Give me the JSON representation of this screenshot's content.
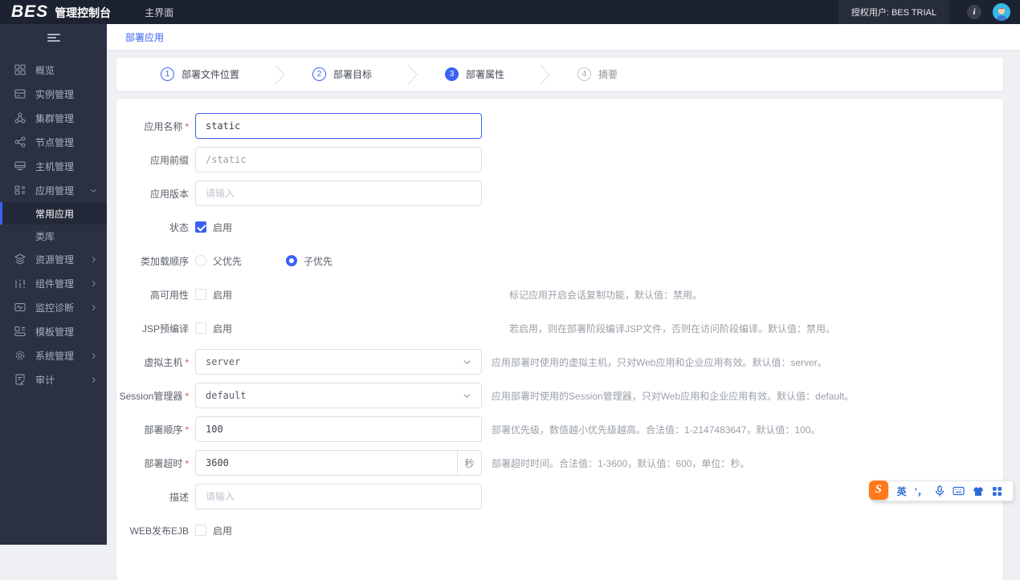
{
  "colors": {
    "accent": "#3a62f2",
    "topbar_bg": "#1d2230",
    "sidebar_bg": "#2b3143",
    "active_border": "#3a62f2",
    "sogou_orange": "#ff7a1c"
  },
  "topbar": {
    "logo_bes": "BES",
    "logo_suffix": "管理控制台",
    "tab_main": "主界面",
    "auth_user": "授权用户: BES TRIAL"
  },
  "sidebar": {
    "items": [
      {
        "label": "概览",
        "icon": "overview-icon"
      },
      {
        "label": "实例管理",
        "icon": "instance-icon"
      },
      {
        "label": "集群管理",
        "icon": "cluster-icon"
      },
      {
        "label": "节点管理",
        "icon": "node-icon"
      },
      {
        "label": "主机管理",
        "icon": "host-icon"
      },
      {
        "label": "应用管理",
        "icon": "app-icon",
        "expanded": true,
        "children": [
          {
            "label": "常用应用",
            "active": true
          },
          {
            "label": "类库"
          }
        ]
      },
      {
        "label": "资源管理",
        "icon": "resource-icon",
        "has_arrow": true
      },
      {
        "label": "组件管理",
        "icon": "component-icon",
        "has_arrow": true
      },
      {
        "label": "监控诊断",
        "icon": "monitor-icon",
        "has_arrow": true
      },
      {
        "label": "模板管理",
        "icon": "template-icon"
      },
      {
        "label": "系统管理",
        "icon": "system-icon",
        "has_arrow": true
      },
      {
        "label": "审计",
        "icon": "audit-icon",
        "has_arrow": true
      }
    ]
  },
  "breadcrumb": "部署应用",
  "steps": [
    {
      "num": "1",
      "label": "部署文件位置",
      "state": "done"
    },
    {
      "num": "2",
      "label": "部署目标",
      "state": "done"
    },
    {
      "num": "3",
      "label": "部署属性",
      "state": "active"
    },
    {
      "num": "4",
      "label": "摘要",
      "state": "pending"
    }
  ],
  "form": {
    "required_mark": "*",
    "fields": [
      {
        "label": "应用名称",
        "required": true,
        "type": "text",
        "value": "static",
        "focused": true
      },
      {
        "label": "应用前缀",
        "type": "text",
        "value": "/static"
      },
      {
        "label": "应用版本",
        "type": "text",
        "placeholder": "请输入"
      },
      {
        "label": "状态",
        "type": "checkbox",
        "option": "启用",
        "checked": true
      },
      {
        "label": "类加载顺序",
        "type": "radio",
        "options": [
          "父优先",
          "子优先"
        ],
        "selected": "子优先"
      },
      {
        "label": "高可用性",
        "type": "checkbox",
        "option": "启用",
        "checked": false,
        "help": "标记应用开启会话复制功能，默认值：禁用。"
      },
      {
        "label": "JSP预编译",
        "type": "checkbox",
        "option": "启用",
        "checked": false,
        "help": "若启用，则在部署阶段编译JSP文件，否则在访问阶段编译。默认值：禁用。"
      },
      {
        "label": "虚拟主机",
        "required": true,
        "type": "select",
        "value": "server",
        "help": "应用部署时使用的虚拟主机，只对Web应用和企业应用有效。默认值：server。"
      },
      {
        "label": "Session管理器",
        "required": true,
        "type": "select",
        "value": "default",
        "help": "应用部署时使用的Session管理器，只对Web应用和企业应用有效。默认值：default。"
      },
      {
        "label": "部署顺序",
        "required": true,
        "type": "text",
        "value": "100",
        "help": "部署优先级，数值越小优先级越高。合法值：1-2147483647，默认值：100。"
      },
      {
        "label": "部署超时",
        "required": true,
        "type": "text",
        "value": "3600",
        "suffix": "秒",
        "help": "部署超时时间。合法值：1-3600，默认值：600，单位：秒。"
      },
      {
        "label": "描述",
        "type": "text",
        "placeholder": "请输入"
      },
      {
        "label": "WEB发布EJB",
        "type": "checkbox",
        "option": "启用",
        "checked": false
      }
    ]
  },
  "ime": {
    "logo": "S",
    "mode": "英",
    "punct": "’，",
    "icons": [
      "microphone-icon",
      "keyboard-icon",
      "skin-icon",
      "toolbox-icon"
    ]
  }
}
